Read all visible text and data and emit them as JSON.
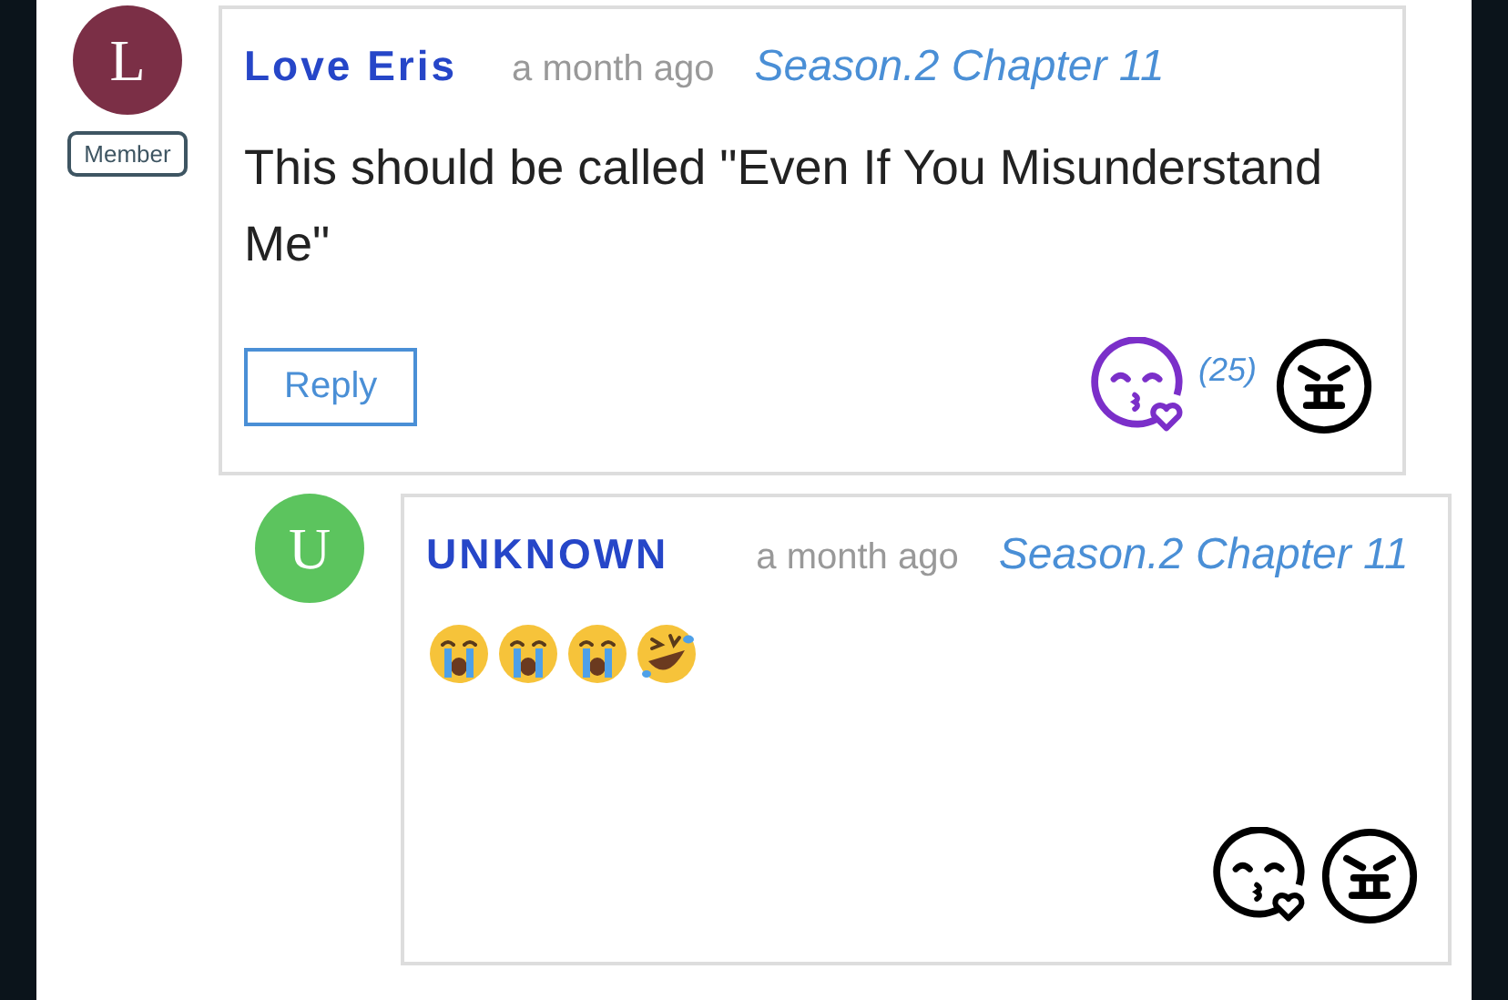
{
  "comments": [
    {
      "avatar_letter": "L",
      "color": "#7b2f46",
      "badge": "Member",
      "author": "Love Eris",
      "time": "a month ago",
      "chapter": "Season.2 Chapter 11",
      "text": "This should be called \"Even If You Misunderstand Me\"",
      "reply_button": "Reply",
      "reactions": [
        {
          "kind": "love",
          "selected": true,
          "count": "(25)"
        },
        {
          "kind": "angry",
          "selected": false
        }
      ],
      "replies": [
        {
          "avatar_letter": "U",
          "color": "#5cc45e",
          "author": "UNKNOWN",
          "time": "a month ago",
          "chapter": "Season.2 Chapter 11",
          "emojis": [
            {
              "kind": "crying"
            },
            {
              "kind": "crying"
            },
            {
              "kind": "crying"
            },
            {
              "kind": "laughing"
            }
          ],
          "reactions": [
            {
              "kind": "love",
              "selected": false
            },
            {
              "kind": "angry",
              "selected": false
            }
          ]
        }
      ]
    }
  ]
}
